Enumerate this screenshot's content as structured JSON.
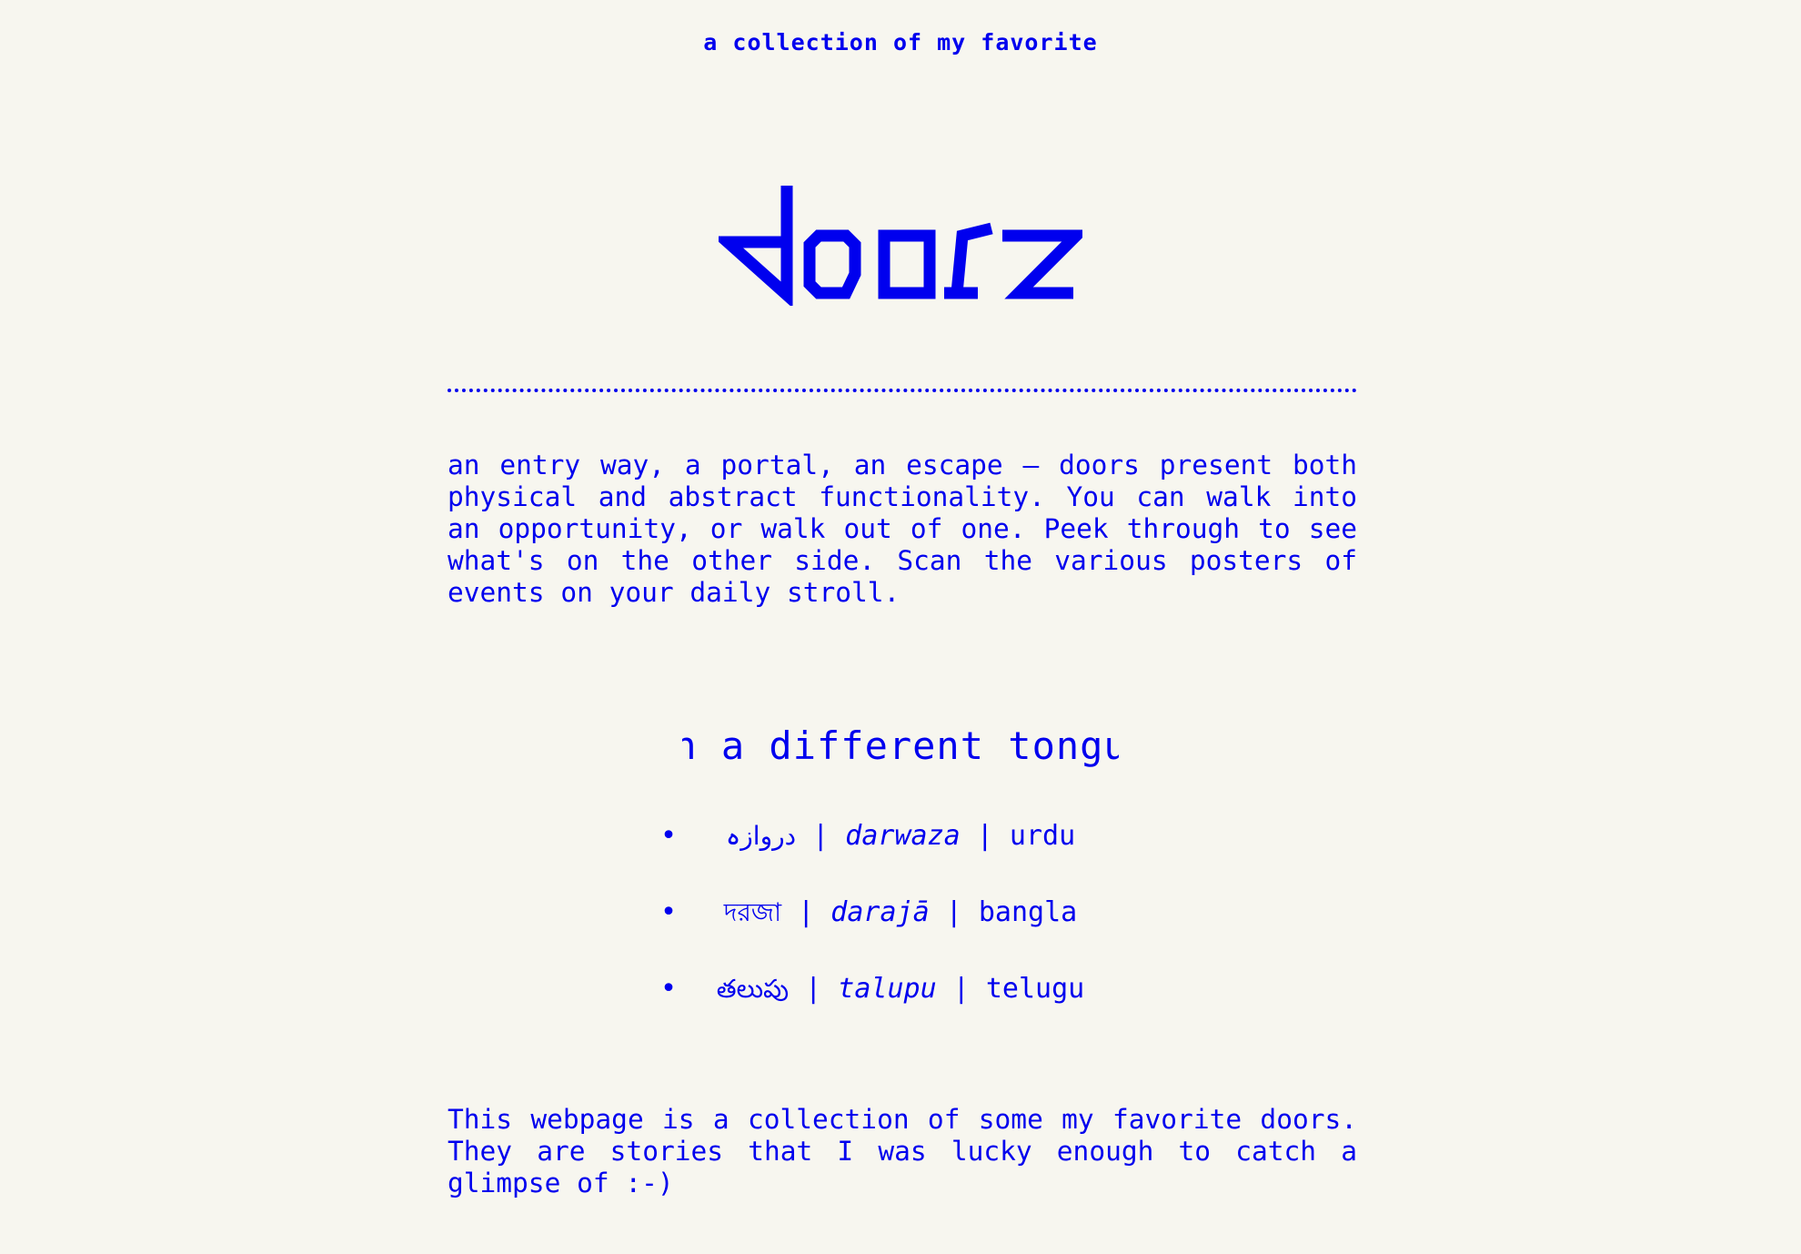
{
  "header": {
    "kicker": "a collection of my favorite",
    "title": "doors"
  },
  "intro": {
    "text": "an entry way, a portal, an escape — doors present both physical and abstract functionality. You can walk into an opportunity, or walk out of one. Peek through to see what's on the other side. Scan the various posters of events on your daily stroll."
  },
  "tongue": {
    "heading": "in a different tongue",
    "items": [
      {
        "native": "دروازہ",
        "separator1": "|",
        "transliteration": "darwaza",
        "separator2": "|",
        "language": "urdu"
      },
      {
        "native": "দরজা",
        "separator1": "|",
        "transliteration": "darajā",
        "separator2": "|",
        "language": "bangla"
      },
      {
        "native": "తలుపు",
        "separator1": "|",
        "transliteration": "talupu",
        "separator2": "|",
        "language": "telugu"
      }
    ]
  },
  "outro": {
    "text": "This webpage is a collection of some my favorite doors. They are stories that I was lucky enough to catch a glimpse of :-)"
  },
  "colors": {
    "background": "#f7f6ef",
    "accent": "#0000ee"
  }
}
